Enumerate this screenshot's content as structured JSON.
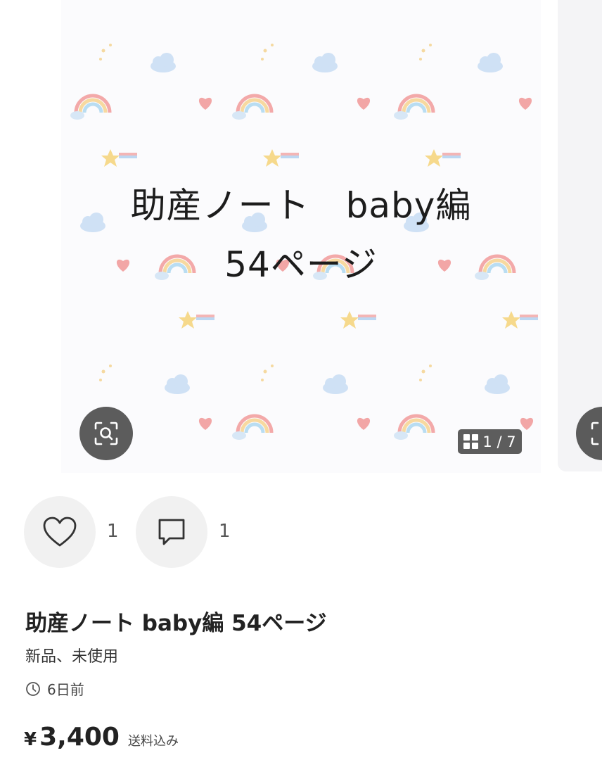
{
  "gallery": {
    "cover_line1": "助産ノート　baby編",
    "cover_line2": "54ページ",
    "counter": "1 / 7",
    "zoom_icon": "zoom-scan-icon",
    "counter_icon": "grid-icon"
  },
  "actions": {
    "like_icon": "heart-icon",
    "like_count": "1",
    "comment_icon": "comment-icon",
    "comment_count": "1"
  },
  "item": {
    "title": "助産ノート baby編 54ページ",
    "condition": "新品、未使用",
    "posted": "6日前",
    "price_symbol": "¥",
    "price": "3,400",
    "shipping": "送料込み"
  },
  "colors": {
    "button_bg": "#f1f1f1",
    "overlay": "#464646",
    "text": "#222222"
  }
}
